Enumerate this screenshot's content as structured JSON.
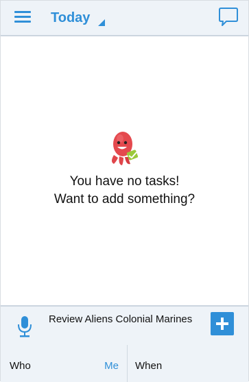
{
  "header": {
    "title": "Today",
    "menu_icon": "hamburger-menu-icon",
    "chat_icon": "speech-bubble-icon",
    "accent_color": "#2f8fd8"
  },
  "empty_state": {
    "mascot_icon": "octopus-mascot-icon",
    "line1": "You have no tasks!",
    "line2": "Want to add something?"
  },
  "composer": {
    "mic_icon": "microphone-icon",
    "task_text": "Review Aliens Colonial Marines",
    "add_icon": "plus-icon",
    "who_label": "Who",
    "who_value": "Me",
    "when_label": "When"
  }
}
